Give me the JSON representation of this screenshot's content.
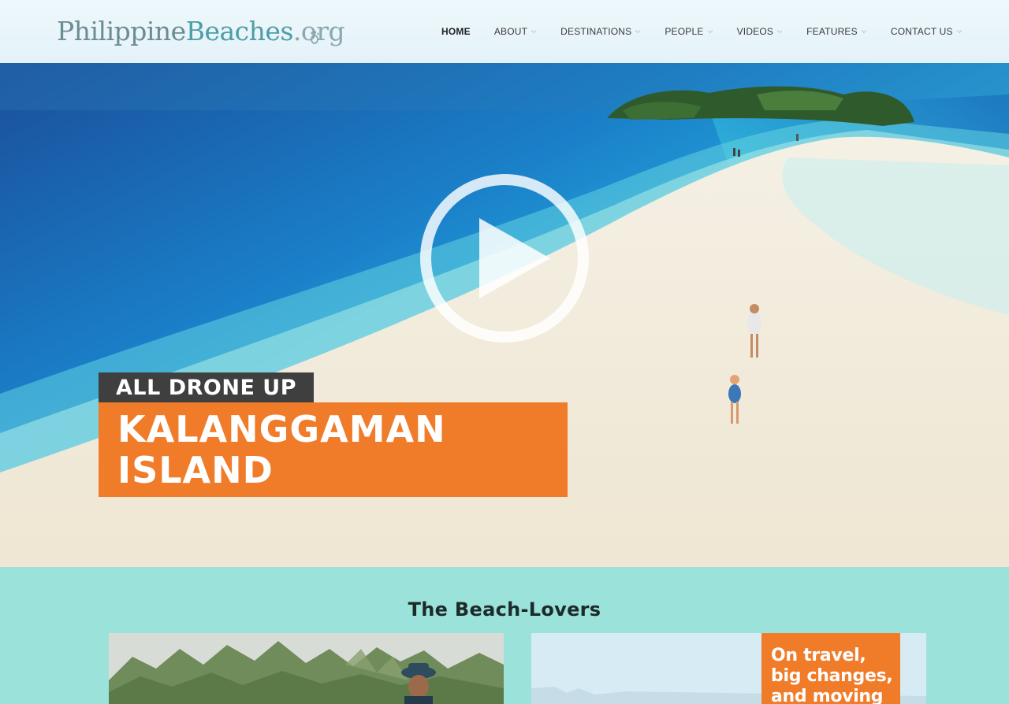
{
  "site": {
    "logo_part1": "Philippine",
    "logo_part2": "Beaches",
    "logo_part3": ".org",
    "logo_alt": "PhilippineBeaches.org"
  },
  "nav": {
    "items": [
      {
        "label": "HOME",
        "active": true,
        "has_dropdown": false
      },
      {
        "label": "ABOUT",
        "active": false,
        "has_dropdown": true
      },
      {
        "label": "DESTINATIONS",
        "active": false,
        "has_dropdown": true
      },
      {
        "label": "PEOPLE",
        "active": false,
        "has_dropdown": true
      },
      {
        "label": "VIDEOS",
        "active": false,
        "has_dropdown": true
      },
      {
        "label": "FEATURES",
        "active": false,
        "has_dropdown": true
      },
      {
        "label": "CONTACT US",
        "active": false,
        "has_dropdown": true
      }
    ]
  },
  "hero": {
    "tag": "ALL DRONE UP",
    "title_line1": "KALANGGAMAN",
    "title_line2": "ISLAND",
    "play_icon": "play-circle-icon"
  },
  "section": {
    "title": "The Beach-Lovers",
    "card2_banner_line1": "On travel,",
    "card2_banner_line2": "big changes,",
    "card2_banner_line3": "and moving"
  },
  "colors": {
    "accent_orange": "#f07c2a",
    "section_bg": "#9ae2da",
    "tag_bg": "#3f3f3f",
    "header_bg": "#eef8fc"
  }
}
